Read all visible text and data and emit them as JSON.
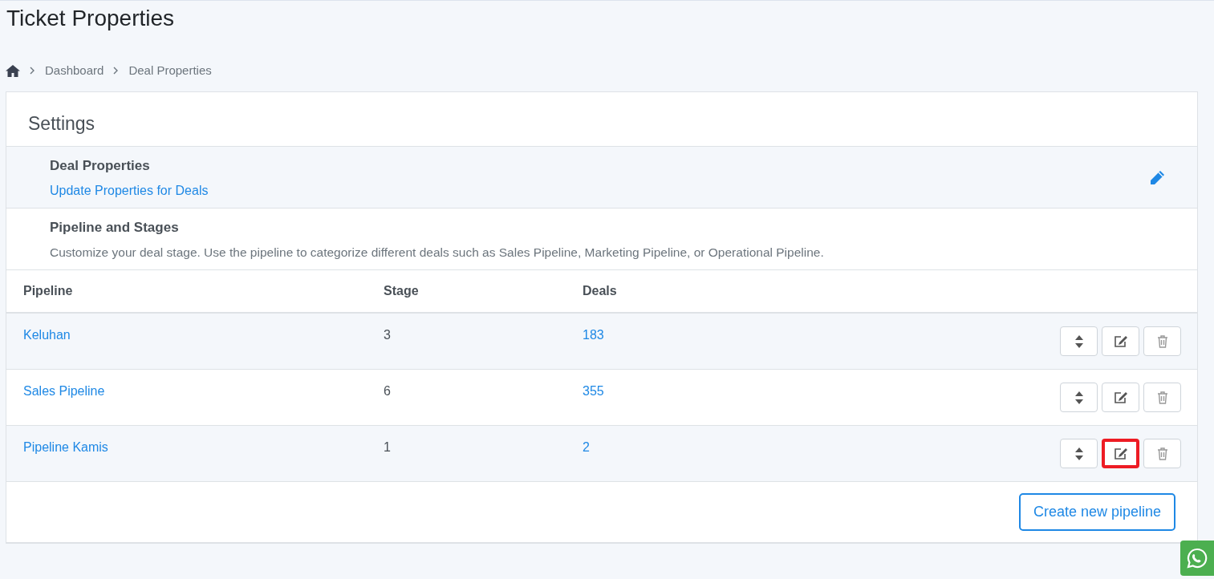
{
  "page_title": "Ticket Properties",
  "breadcrumb": [
    "Dashboard",
    "Deal Properties"
  ],
  "card": {
    "title": "Settings",
    "deal_properties": {
      "title": "Deal Properties",
      "link": "Update Properties for Deals"
    },
    "pipeline_section": {
      "title": "Pipeline and Stages",
      "description": "Customize your deal stage. Use the pipeline to categorize different deals such as Sales Pipeline, Marketing Pipeline, or Operational Pipeline."
    },
    "table": {
      "columns": [
        "Pipeline",
        "Stage",
        "Deals"
      ],
      "rows": [
        {
          "pipeline": "Keluhan",
          "stage": "3",
          "deals": "183",
          "edit_highlighted": false
        },
        {
          "pipeline": "Sales Pipeline",
          "stage": "6",
          "deals": "355",
          "edit_highlighted": false
        },
        {
          "pipeline": "Pipeline Kamis",
          "stage": "1",
          "deals": "2",
          "edit_highlighted": true
        }
      ]
    },
    "create_button": "Create new pipeline"
  }
}
